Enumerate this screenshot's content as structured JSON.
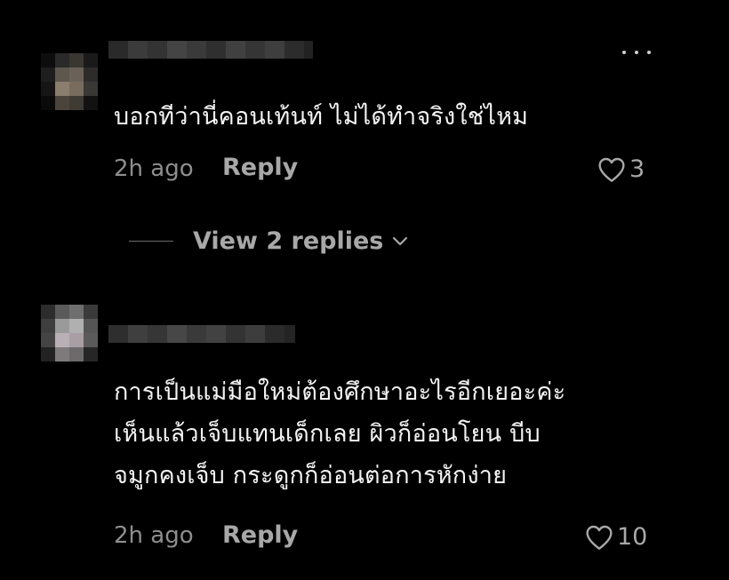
{
  "comments": [
    {
      "text": "บอกทีว่านี่คอนเท้นท์ ไม่ได้ทำจริงใช่ไหม",
      "time": "2h ago",
      "reply_label": "Reply",
      "likes": "3"
    },
    {
      "text": "การเป็นแม่มือใหม่ต้องศึกษาอะไรอีกเยอะค่ะ\nเห็นแล้วเจ็บแทนเด็กเลย ผิวก็อ่อนโยน บีบ\nจมูกคงเจ็บ กระดูกก็อ่อนต่อการหักง่าย",
      "time": "2h ago",
      "reply_label": "Reply",
      "likes": "10"
    }
  ],
  "view_replies": {
    "label": "View 2 replies"
  },
  "icons": {
    "more": "more-options-icon",
    "heart": "heart-icon",
    "chevron": "chevron-down-icon"
  },
  "colors": {
    "background": "#000000",
    "text": "#f3f3f3",
    "muted": "#8e8e8e",
    "secondary": "#a8a8a8"
  }
}
